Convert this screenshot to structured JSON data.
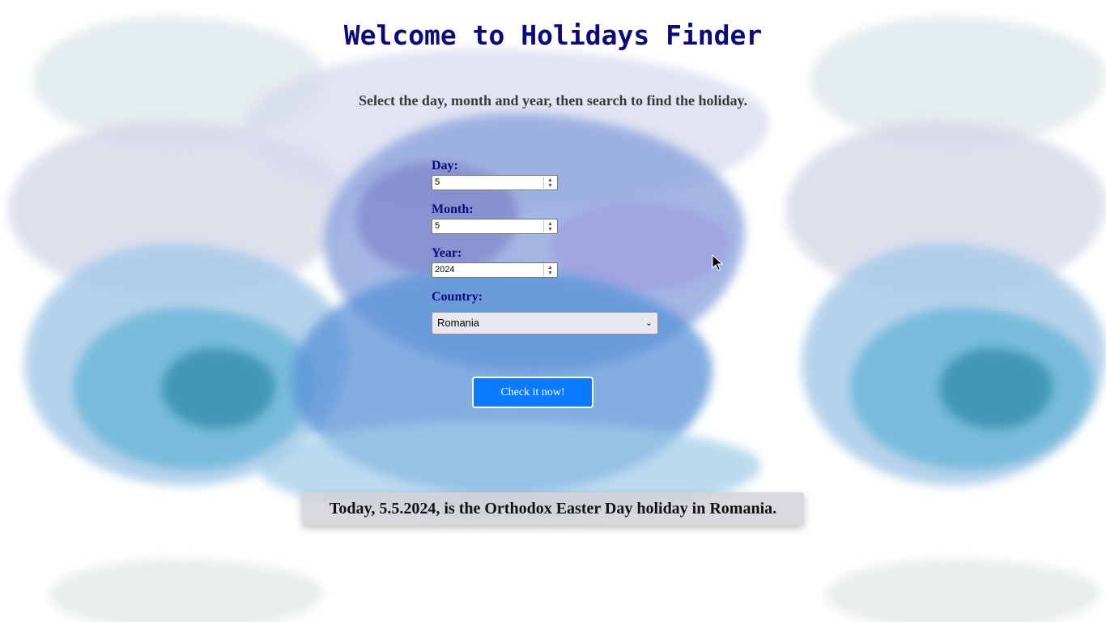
{
  "page": {
    "title": "Welcome to Holidays Finder",
    "subtitle": "Select the day, month and year, then search to find the holiday."
  },
  "form": {
    "day": {
      "label": "Day:",
      "value": "5"
    },
    "month": {
      "label": "Month:",
      "value": "5"
    },
    "year": {
      "label": "Year:",
      "value": "2024"
    },
    "country": {
      "label": "Country:",
      "selected": "Romania"
    },
    "submit_label": "Check it now!"
  },
  "result": {
    "text": "Today, 5.5.2024, is the Orthodox Easter Day holiday in Romania."
  },
  "colors": {
    "title": "#0a0a7a",
    "button": "#0a7bff",
    "label": "#0a0a7a"
  },
  "icons": {
    "spinner": "spinner-arrows-icon",
    "select": "chevron-down-icon",
    "cursor": "mouse-pointer-icon"
  }
}
